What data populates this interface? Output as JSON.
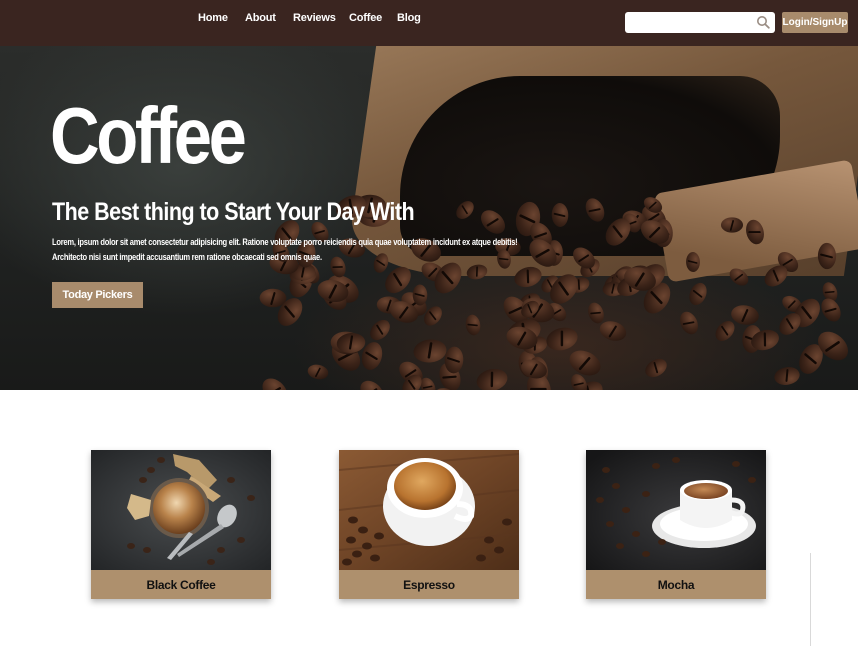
{
  "nav": {
    "links": [
      {
        "label": "Home"
      },
      {
        "label": "About"
      },
      {
        "label": "Reviews"
      },
      {
        "label": "Coffee"
      },
      {
        "label": "Blog"
      }
    ],
    "search": {
      "value": "",
      "placeholder": "",
      "icon": "search-icon"
    },
    "login_label": "Login/SignUp",
    "bar_color": "#3a2520",
    "accent_color": "#a88b6c"
  },
  "hero": {
    "title": "Coffee",
    "subtitle": "The Best thing to Start Your Day With",
    "description_lines": [
      "Lorem, ipsum dolor sit amet consectetur adipisicing elit. Ratione voluptate porro reiciendis quia quae voluptatem incidunt ex atque debitis!",
      "Architecto nisi sunt impedit accusantium rem ratione obcaecati sed omnis quae."
    ],
    "cta_label": "Today Pickers"
  },
  "cards": [
    {
      "label": "Black Coffee"
    },
    {
      "label": "Espresso"
    },
    {
      "label": "Mocha"
    }
  ]
}
